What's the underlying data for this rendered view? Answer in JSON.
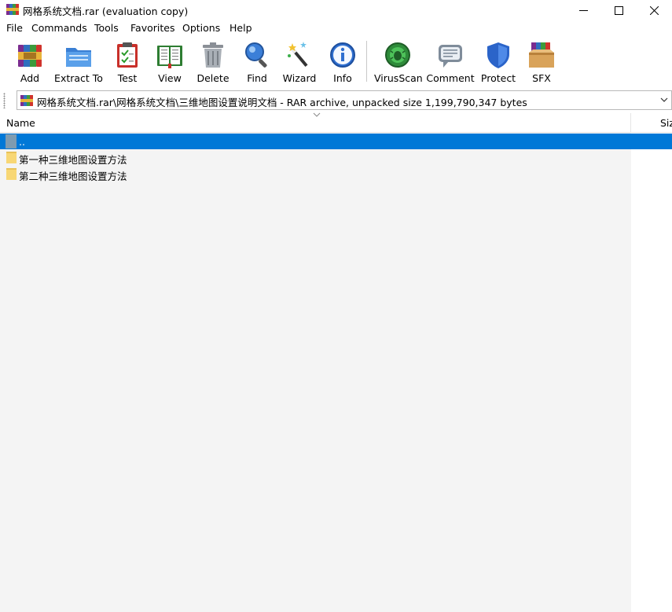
{
  "window": {
    "title": "网格系统文档.rar (evaluation copy)"
  },
  "menu": [
    "File",
    "Commands",
    "Tools",
    "Favorites",
    "Options",
    "Help"
  ],
  "toolbar": [
    {
      "label": "Add",
      "icon": "add-archive-icon"
    },
    {
      "label": "Extract To",
      "icon": "extract-folder-icon"
    },
    {
      "label": "Test",
      "icon": "test-clipboard-icon"
    },
    {
      "label": "View",
      "icon": "view-book-icon"
    },
    {
      "label": "Delete",
      "icon": "delete-trash-icon"
    },
    {
      "label": "Find",
      "icon": "find-magnifier-icon"
    },
    {
      "label": "Wizard",
      "icon": "wizard-wand-icon"
    },
    {
      "label": "Info",
      "icon": "info-icon"
    },
    {
      "label": "VirusScan",
      "icon": "virus-scan-icon"
    },
    {
      "label": "Comment",
      "icon": "comment-icon"
    },
    {
      "label": "Protect",
      "icon": "protect-shield-icon"
    },
    {
      "label": "SFX",
      "icon": "sfx-box-icon"
    }
  ],
  "address": {
    "path": "网格系统文档.rar\\网格系统文档\\三维地图设置说明文档 - RAR archive, unpacked size 1,199,790,347 bytes"
  },
  "columns": {
    "name": "Name",
    "size": "Siz"
  },
  "files": [
    {
      "name": "..",
      "type": "parent",
      "selected": true
    },
    {
      "name": "第一种三维地图设置方法",
      "type": "folder",
      "selected": false
    },
    {
      "name": "第二种三维地图设置方法",
      "type": "folder",
      "selected": false
    }
  ],
  "colors": {
    "selection": "#0078d7",
    "folder": "#f8d775"
  }
}
